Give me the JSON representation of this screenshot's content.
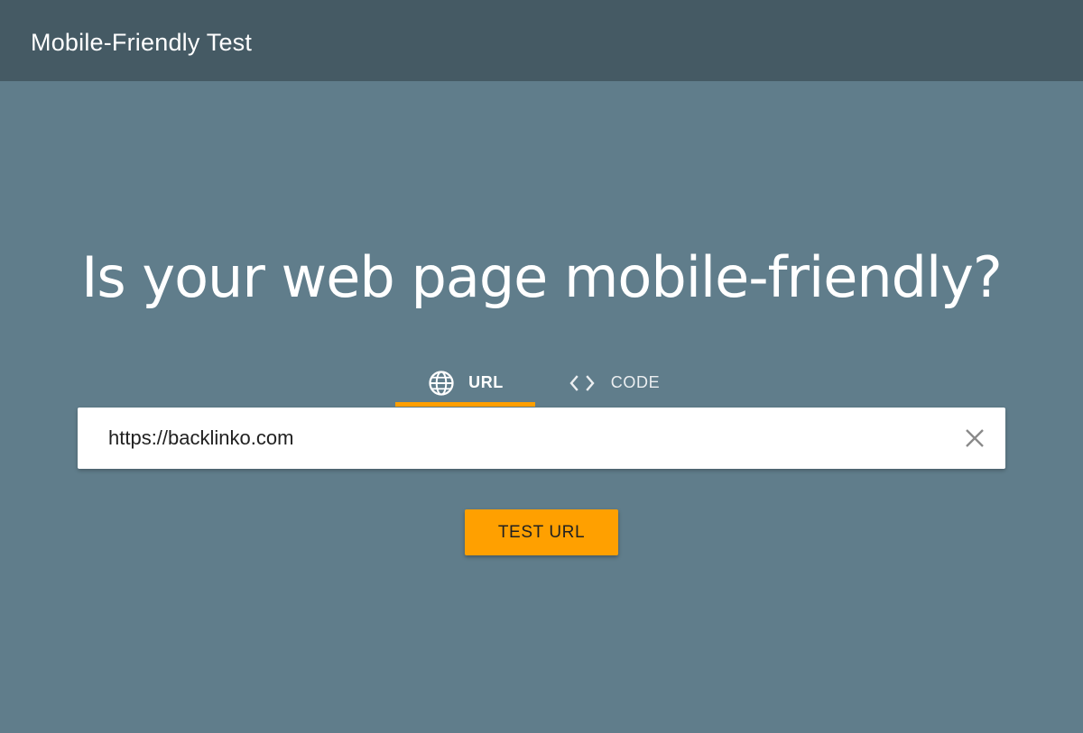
{
  "header": {
    "title": "Mobile-Friendly Test"
  },
  "main": {
    "headline": "Is your web page mobile-friendly?",
    "tabs": [
      {
        "label": "URL",
        "icon": "globe-icon",
        "selected": true
      },
      {
        "label": "CODE",
        "icon": "code-icon",
        "selected": false
      }
    ],
    "url_input": {
      "value": "https://backlinko.com",
      "clear_icon": "close-icon"
    },
    "test_button_label": "TEST URL"
  },
  "colors": {
    "background": "#607d8b",
    "header": "#455a64",
    "accent": "#ffa000"
  }
}
